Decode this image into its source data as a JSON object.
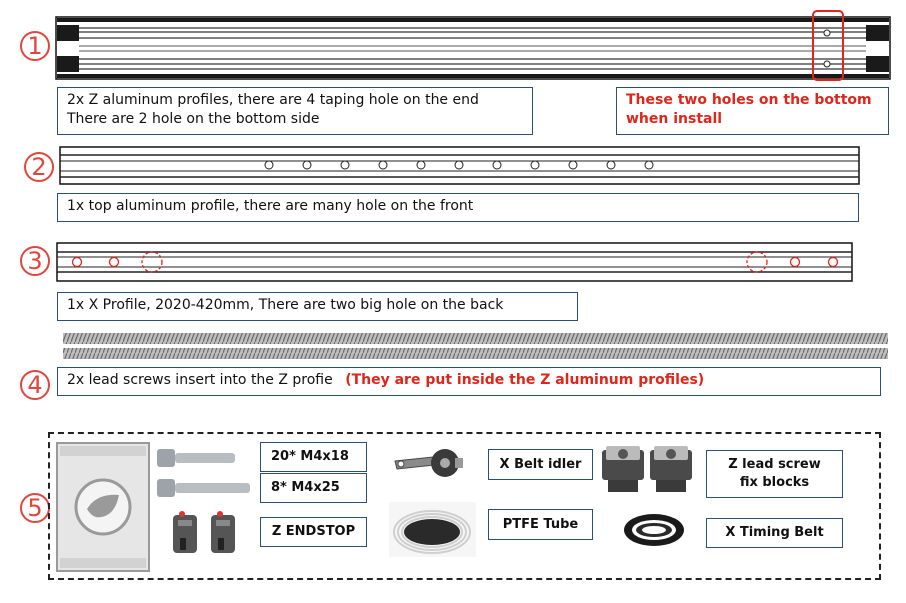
{
  "items": [
    {
      "number": "1",
      "description_lines": [
        "2x Z aluminum profiles, there are 4 taping hole on the end",
        "There are 2 hole on the bottom side"
      ],
      "note_lines": [
        "These two holes on the bottom",
        "when install"
      ]
    },
    {
      "number": "2",
      "description": "1x top aluminum profile, there are many hole on the front"
    },
    {
      "number": "3",
      "description": "1x X Profile, 2020-420mm, There are two big hole on the back"
    },
    {
      "number": "4",
      "description": "2x lead screws insert into the Z profie",
      "note": "(They are put inside the Z aluminum profiles)"
    },
    {
      "number": "5",
      "parts": {
        "screws_a": "20* M4x18",
        "screws_b": "8* M4x25",
        "endstop": "Z ENDSTOP",
        "belt_idler": "X Belt idler",
        "ptfe_tube": "PTFE Tube",
        "lead_screw_blocks": [
          "Z lead screw",
          "fix blocks"
        ],
        "timing_belt": "X Timing Belt"
      }
    }
  ],
  "colors": {
    "accent": "#e0463e",
    "note_red": "#e0251a",
    "box_border": "#2b4f77"
  }
}
